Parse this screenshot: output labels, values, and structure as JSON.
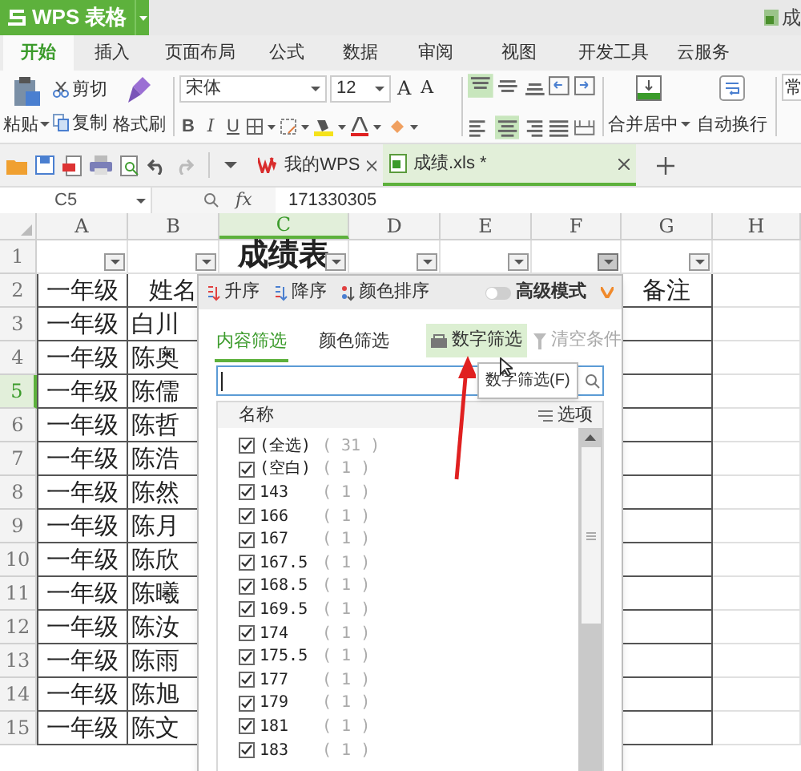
{
  "window": {
    "app": "WPS 表格",
    "title": "成"
  },
  "menu": [
    {
      "label": "开始",
      "selected": true
    },
    {
      "label": "插入",
      "selected": false
    },
    {
      "label": "页面布局",
      "selected": false
    },
    {
      "label": "公式",
      "selected": false
    },
    {
      "label": "数据",
      "selected": false
    },
    {
      "label": "审阅",
      "selected": false
    },
    {
      "label": "视图",
      "selected": false
    },
    {
      "label": "开发工具",
      "selected": false
    },
    {
      "label": "云服务",
      "selected": false
    }
  ],
  "ribbon": {
    "paste": "粘贴",
    "cut": "剪切",
    "copy": "复制",
    "format_painter": "格式刷",
    "font": "宋体",
    "font_size": "12",
    "font_grow": "A",
    "font_shrink": "A",
    "styles": [
      "B",
      "I",
      "U"
    ],
    "vertical_align": [
      {
        "kind": "top",
        "selected": true
      },
      {
        "kind": "middle",
        "selected": false
      },
      {
        "kind": "bottom",
        "selected": false
      }
    ],
    "horizontal_align": [
      {
        "kind": "left",
        "selected": false
      },
      {
        "kind": "center",
        "selected": true
      },
      {
        "kind": "right",
        "selected": false
      },
      {
        "kind": "justify",
        "selected": false
      }
    ],
    "merge": "合并居中",
    "wrap": "自动换行",
    "style_cut": "常"
  },
  "doc_tabs": [
    {
      "label": "我的WPS",
      "selected": false
    },
    {
      "label": "成绩.xls *",
      "selected": true
    }
  ],
  "formula_bar": {
    "cell": "C5",
    "fx": "fx",
    "value": "171330305"
  },
  "sheet": {
    "columns": [
      {
        "label": "A",
        "selected": false,
        "filter_button": true,
        "filter_open": false
      },
      {
        "label": "B",
        "selected": false,
        "filter_button": true,
        "filter_open": false
      },
      {
        "label": "C",
        "selected": true,
        "filter_button": true,
        "filter_open": false
      },
      {
        "label": "D",
        "selected": false,
        "filter_button": true,
        "filter_open": false
      },
      {
        "label": "E",
        "selected": false,
        "filter_button": true,
        "filter_open": false
      },
      {
        "label": "F",
        "selected": false,
        "filter_button": true,
        "filter_open": true
      },
      {
        "label": "G",
        "selected": false,
        "filter_button": true,
        "filter_open": false
      },
      {
        "label": "H",
        "selected": false,
        "filter_button": false
      }
    ],
    "rows": [
      {
        "number": "1",
        "selected": false,
        "kind": "title",
        "cells": {
          "C": "成绩表"
        }
      },
      {
        "number": "2",
        "selected": false,
        "kind": "header",
        "cells": {
          "A": "一年级",
          "B": "姓名",
          "G": "备注"
        }
      },
      {
        "number": "3",
        "selected": false,
        "kind": "data",
        "cells": {
          "A": "一年级",
          "B": "白川"
        }
      },
      {
        "number": "4",
        "selected": false,
        "kind": "data",
        "cells": {
          "A": "一年级",
          "B": "陈奥"
        }
      },
      {
        "number": "5",
        "selected": true,
        "kind": "data",
        "cells": {
          "A": "一年级",
          "B": "陈儒"
        }
      },
      {
        "number": "6",
        "selected": false,
        "kind": "data",
        "cells": {
          "A": "一年级",
          "B": "陈哲"
        }
      },
      {
        "number": "7",
        "selected": false,
        "kind": "data",
        "cells": {
          "A": "一年级",
          "B": "陈浩"
        }
      },
      {
        "number": "8",
        "selected": false,
        "kind": "data",
        "cells": {
          "A": "一年级",
          "B": "陈然"
        }
      },
      {
        "number": "9",
        "selected": false,
        "kind": "data",
        "cells": {
          "A": "一年级",
          "B": "陈月"
        }
      },
      {
        "number": "10",
        "selected": false,
        "kind": "data",
        "cells": {
          "A": "一年级",
          "B": "陈欣"
        }
      },
      {
        "number": "11",
        "selected": false,
        "kind": "data",
        "cells": {
          "A": "一年级",
          "B": "陈曦"
        }
      },
      {
        "number": "12",
        "selected": false,
        "kind": "data",
        "cells": {
          "A": "一年级",
          "B": "陈汝"
        }
      },
      {
        "number": "13",
        "selected": false,
        "kind": "data",
        "cells": {
          "A": "一年级",
          "B": "陈雨"
        }
      },
      {
        "number": "14",
        "selected": false,
        "kind": "data",
        "cells": {
          "A": "一年级",
          "B": "陈旭"
        }
      },
      {
        "number": "15",
        "selected": false,
        "kind": "data",
        "cells": {
          "A": "一年级",
          "B": "陈文"
        }
      }
    ]
  },
  "filter_popup": {
    "sort": [
      {
        "kind": "asc",
        "label": "升序"
      },
      {
        "kind": "desc",
        "label": "降序"
      },
      {
        "kind": "color",
        "label": "颜色排序"
      }
    ],
    "advanced": {
      "label": "高级模式",
      "on": false
    },
    "tabs": [
      {
        "label": "内容筛选",
        "selected": true
      },
      {
        "label": "颜色筛选",
        "selected": false
      }
    ],
    "number_filter": {
      "label": "数字筛选",
      "hovered": true
    },
    "clear": {
      "label": "清空条件",
      "disabled": true
    },
    "list_header": "名称",
    "options": "选项",
    "items": [
      {
        "label": "(全选)",
        "count": "( 31 )",
        "checked": true
      },
      {
        "label": "(空白)",
        "count": "( 1 )",
        "checked": true
      },
      {
        "label": "143",
        "count": "( 1 )",
        "checked": true
      },
      {
        "label": "166",
        "count": "( 1 )",
        "checked": true
      },
      {
        "label": "167",
        "count": "( 1 )",
        "checked": true
      },
      {
        "label": "167.5",
        "count": "( 1 )",
        "checked": true
      },
      {
        "label": "168.5",
        "count": "( 1 )",
        "checked": true
      },
      {
        "label": "169.5",
        "count": "( 1 )",
        "checked": true
      },
      {
        "label": "174",
        "count": "( 1 )",
        "checked": true
      },
      {
        "label": "175.5",
        "count": "( 1 )",
        "checked": true
      },
      {
        "label": "177",
        "count": "( 1 )",
        "checked": true
      },
      {
        "label": "179",
        "count": "( 1 )",
        "checked": true
      },
      {
        "label": "181",
        "count": "( 1 )",
        "checked": true
      },
      {
        "label": "183",
        "count": "( 1 )",
        "checked": true
      }
    ],
    "tooltip": "数字筛选(F)"
  }
}
